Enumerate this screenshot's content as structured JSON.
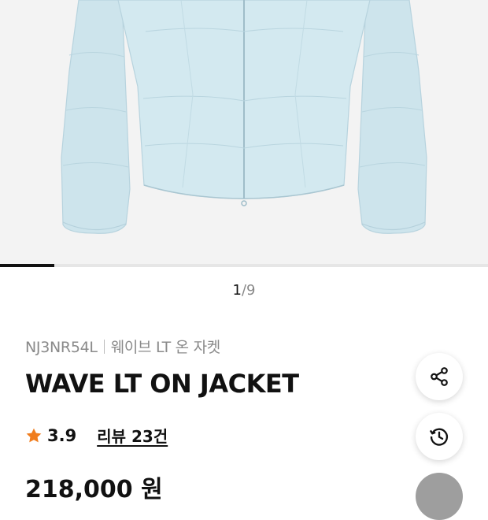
{
  "gallery": {
    "current_page": "1",
    "separator": "/",
    "total_pages": "9",
    "progress_fraction": 0.111
  },
  "product": {
    "code": "NJ3NR54L",
    "name_ko": "웨이브 LT 온 자켓",
    "name_en": "WAVE LT ON JACKET",
    "rating": "3.9",
    "review_label": "리뷰 23건",
    "price": "218,000 원"
  },
  "icons": {
    "share": "share-icon",
    "history": "history-icon",
    "star": "star-icon"
  },
  "colors": {
    "star": "#f07d1e",
    "jacket": "#cfe6ee",
    "hero_bg": "#f3f3f3"
  }
}
